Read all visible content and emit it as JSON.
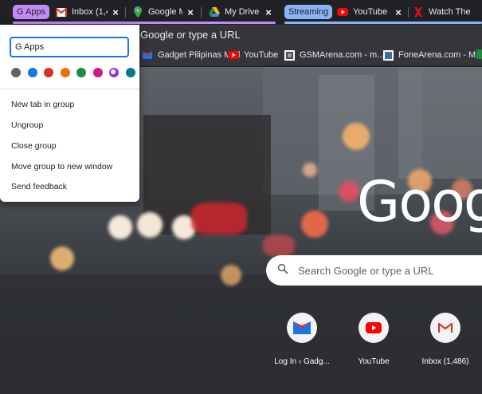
{
  "tabs": {
    "group_gapps": {
      "label": "G Apps",
      "color": "#c58af9"
    },
    "group_streaming": {
      "label": "Streaming",
      "color": "#8ab4f8"
    },
    "items": [
      {
        "title": "Inbox (1,4",
        "icon": "gmail-icon"
      },
      {
        "title": "Google M",
        "icon": "google-maps-icon"
      },
      {
        "title": "My Drive",
        "icon": "google-drive-icon"
      },
      {
        "title": "YouTube",
        "icon": "youtube-icon"
      },
      {
        "title": "Watch The",
        "icon": "x-brand-icon"
      }
    ],
    "close_glyph": "×"
  },
  "omnibox": {
    "placeholder": "Google or type a URL"
  },
  "bookmarks": [
    {
      "label": "Gadget Pilipinas Mail",
      "icon": "gadget-pilipinas-icon"
    },
    {
      "label": "YouTube",
      "icon": "youtube-icon"
    },
    {
      "label": "GSMArena.com - m...",
      "icon": "gsmarena-icon"
    },
    {
      "label": "FoneArena.com - M...",
      "icon": "fonearena-icon"
    }
  ],
  "group_editor": {
    "name_value": "G Apps",
    "colors": [
      "#5f6368",
      "#1a73e8",
      "#d93025",
      "#e8710a",
      "#1e8e3e",
      "#d01884",
      "#9334e6",
      "#007b83"
    ],
    "selected_color_index": 6,
    "menu": [
      "New tab in group",
      "Ungroup",
      "Close group",
      "Move group to new window",
      "Send feedback"
    ]
  },
  "ntp": {
    "logo_text": "Goog",
    "search_placeholder": "Search Google or type a URL",
    "shortcuts": [
      {
        "label": "Log In ‹ Gadg...",
        "icon": "gadget-pilipinas-icon"
      },
      {
        "label": "YouTube",
        "icon": "youtube-icon"
      },
      {
        "label": "Inbox (1,486)",
        "icon": "gmail-icon"
      }
    ]
  }
}
